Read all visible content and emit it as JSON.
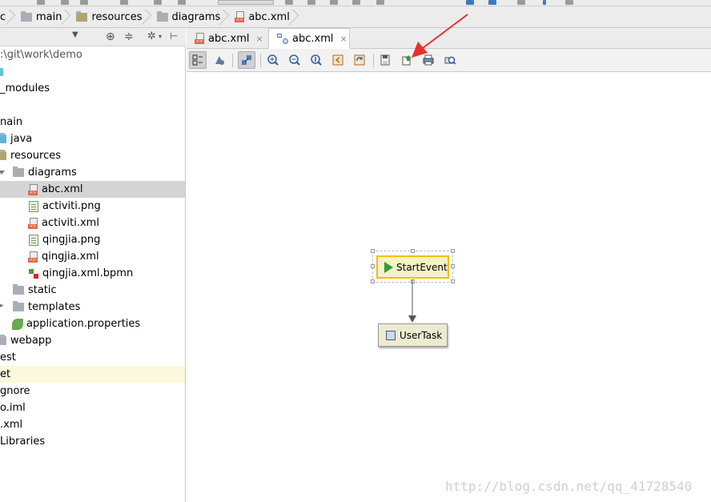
{
  "breadcrumb": {
    "items": [
      "c",
      "main",
      "resources",
      "diagrams",
      "abc.xml"
    ]
  },
  "project_tree": {
    "rows": [
      {
        "label": ":\\git\\work\\demo"
      },
      {
        "label": ""
      },
      {
        "label": "_modules"
      },
      {
        "label": ""
      },
      {
        "label": "nain"
      },
      {
        "label": "java"
      },
      {
        "label": "resources"
      },
      {
        "label": "diagrams"
      },
      {
        "label": "abc.xml"
      },
      {
        "label": "activiti.png"
      },
      {
        "label": "activiti.xml"
      },
      {
        "label": "qingjia.png"
      },
      {
        "label": "qingjia.xml"
      },
      {
        "label": "qingjia.xml.bpmn"
      },
      {
        "label": "static"
      },
      {
        "label": "templates"
      },
      {
        "label": "application.properties"
      },
      {
        "label": "webapp"
      },
      {
        "label": "est"
      },
      {
        "label": "et"
      },
      {
        "label": "gnore"
      },
      {
        "label": "o.iml"
      },
      {
        "label": ".xml"
      },
      {
        "label": " Libraries"
      }
    ]
  },
  "editor_tabs": [
    {
      "label": "abc.xml",
      "close": "×"
    },
    {
      "label": "abc.xml",
      "close": "×"
    }
  ],
  "diagram": {
    "start_event": "StartEvent",
    "user_task": "UserTask"
  },
  "watermark": "http://blog.csdn.net/qq_41728540",
  "colors": {
    "selected_row": "#d5d5d5",
    "highlight_row": "#fbf8dc",
    "start_event_border": "#f0c000",
    "arrow": "#e8302a"
  },
  "icons": [
    "gear-icon",
    "target-icon",
    "split-icon",
    "pin-icon",
    "zoom-in-icon",
    "zoom-out-icon",
    "zoom-actual-icon",
    "export-icon",
    "save-icon",
    "print-icon"
  ]
}
